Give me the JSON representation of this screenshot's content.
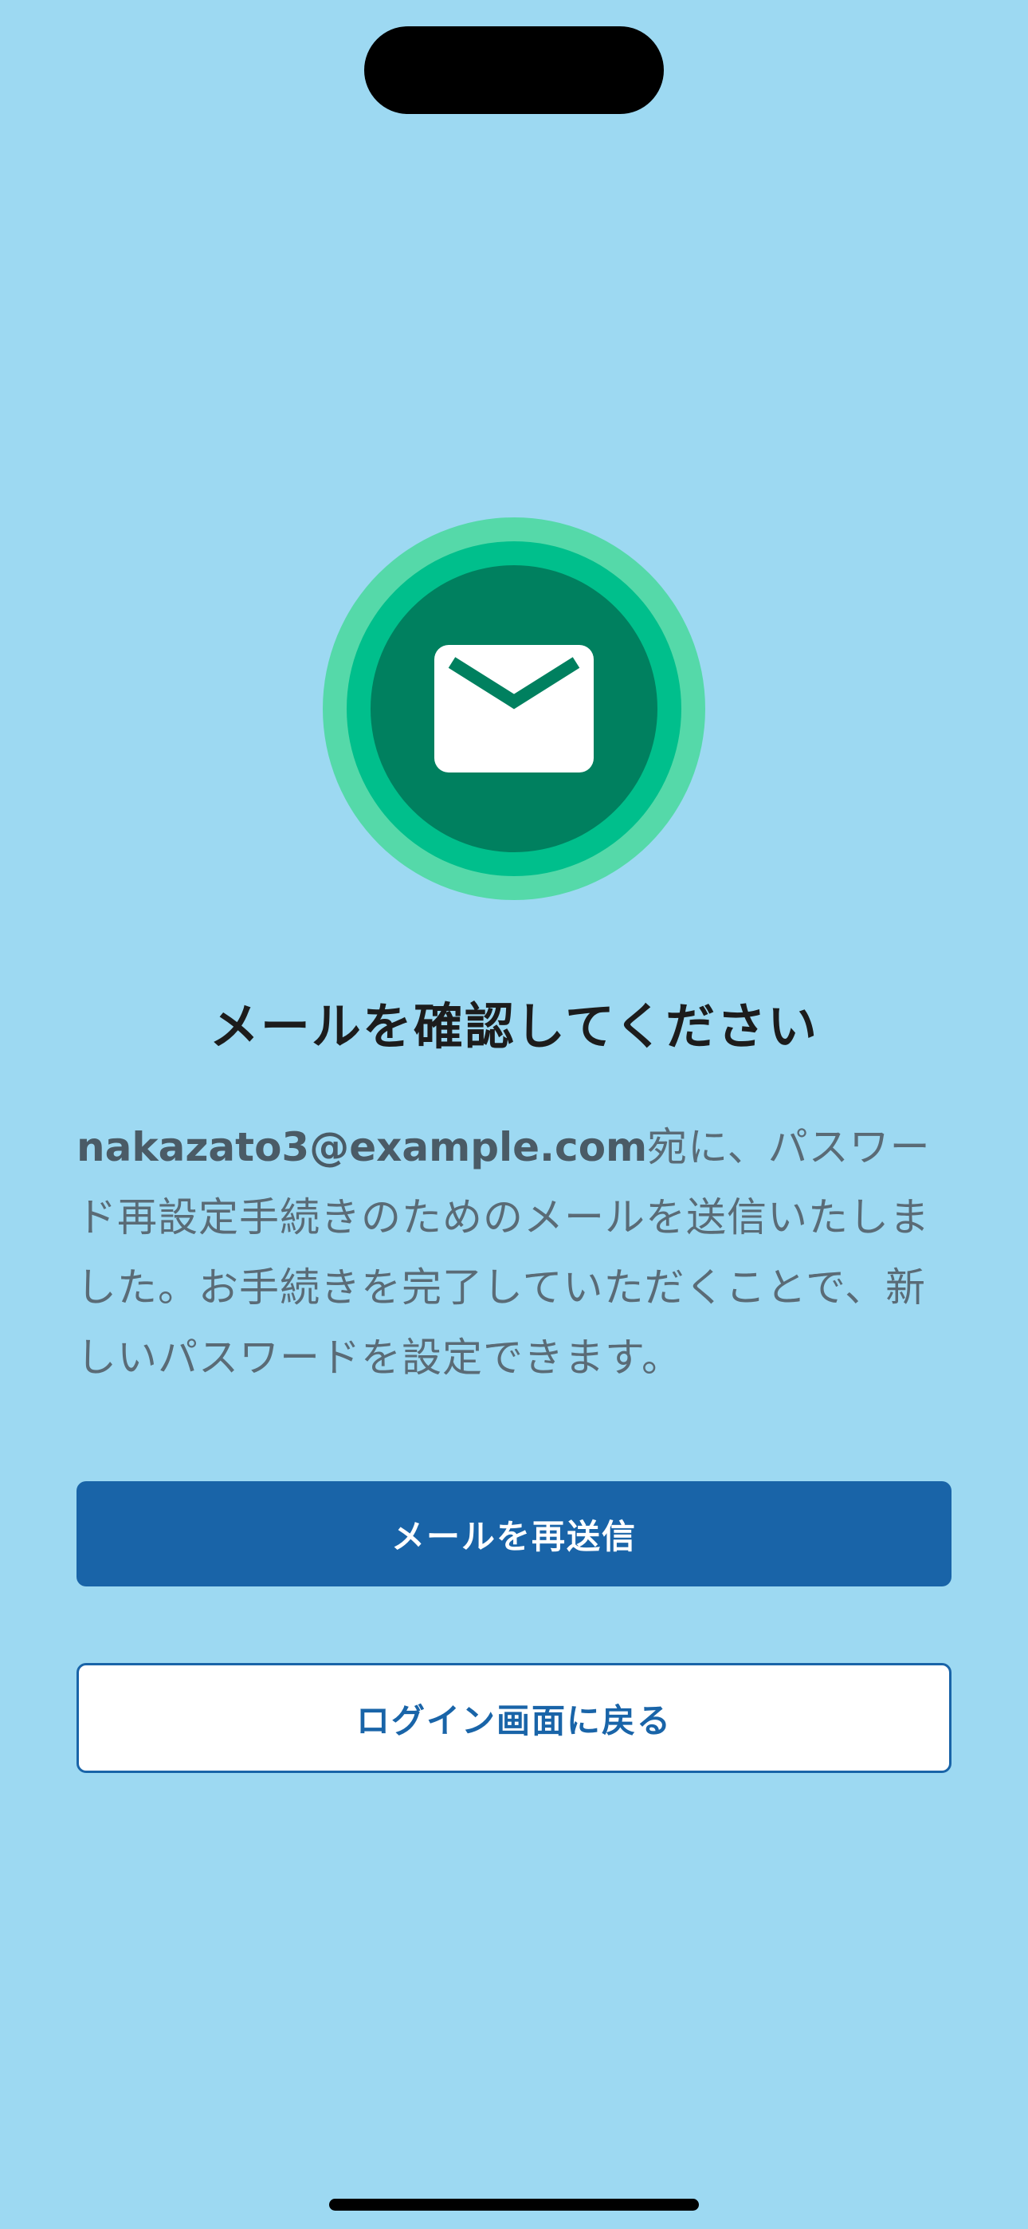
{
  "icon": {
    "name": "mail-icon",
    "colors": {
      "outer_ring": "#55d9a9",
      "middle_ring": "#00bf8c",
      "inner_circle": "#00805f",
      "envelope": "#ffffff"
    }
  },
  "title": "メールを確認してください",
  "message": {
    "email": "nakazato3@example.com",
    "body": "宛に、パスワード再設定手続きのためのメールを送信いたしました。お手続きを完了していただくことで、新しいパスワードを設定できます。"
  },
  "buttons": {
    "resend_label": "メールを再送信",
    "back_label": "ログイン画面に戻る"
  },
  "colors": {
    "background": "#9dd9f2",
    "primary": "#1964a8"
  }
}
